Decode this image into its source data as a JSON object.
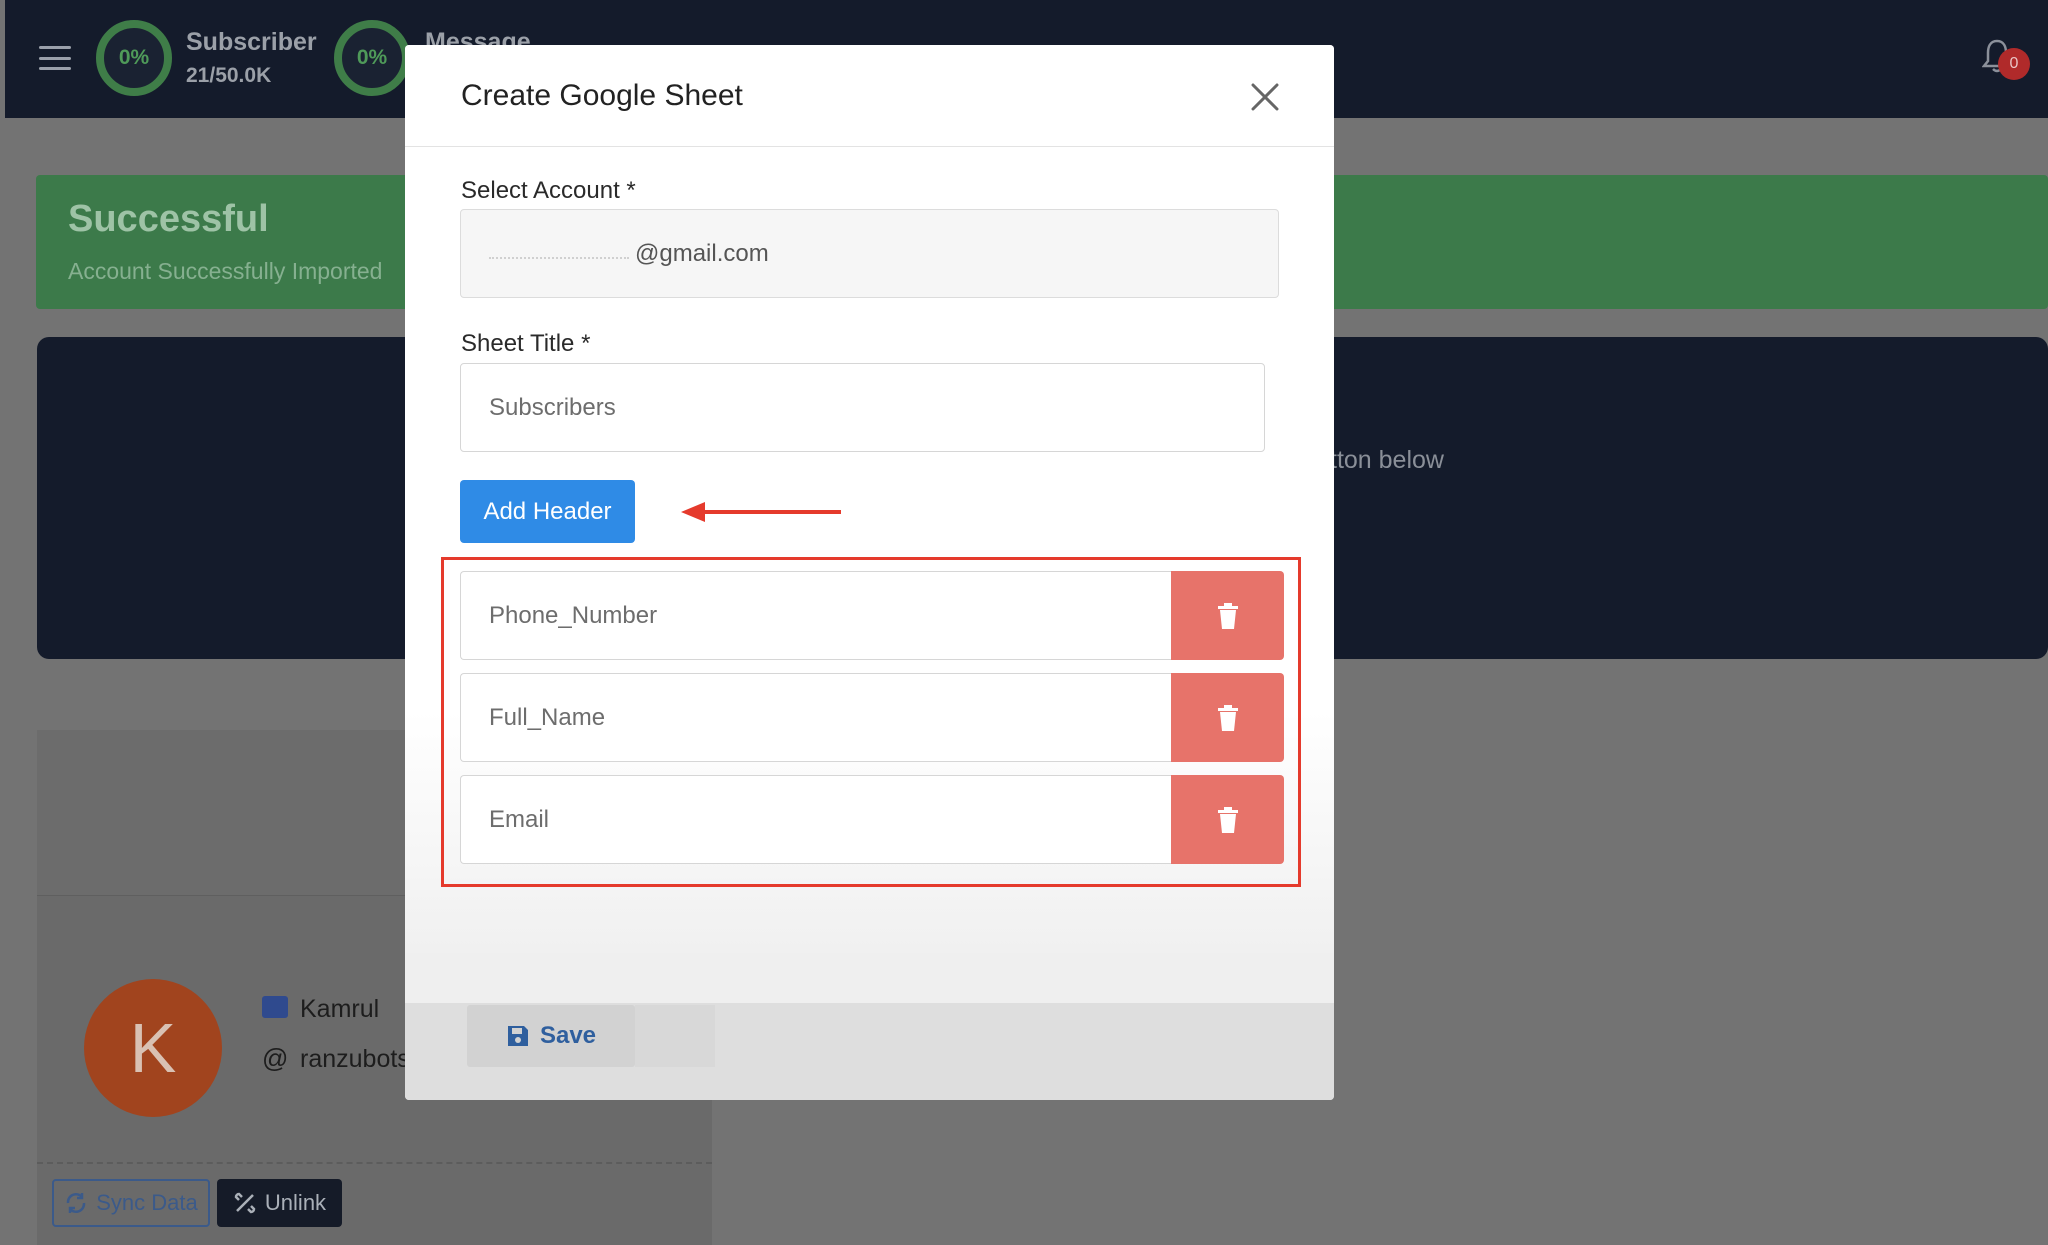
{
  "topbar": {
    "stats": [
      {
        "percent": "0%",
        "title": "Subscriber",
        "value": "21/50.0K"
      },
      {
        "percent": "0%",
        "title": "Message",
        "value": ""
      }
    ],
    "notification_count": "0"
  },
  "alert": {
    "title": "Successful",
    "message": "Account Successfully Imported"
  },
  "dark_card": {
    "text": "tton below"
  },
  "profile": {
    "avatar_letter": "K",
    "name": "Kamrul",
    "username": "ranzubots",
    "sync_label": "Sync Data",
    "unlink_label": "Unlink"
  },
  "modal": {
    "title": "Create Google Sheet",
    "select_account_label": "Select Account *",
    "selected_account": "@gmail.com",
    "sheet_title_label": "Sheet Title *",
    "sheet_title_value": "Subscribers",
    "add_header_label": "Add Header",
    "headers": [
      "Phone_Number",
      "Full_Name",
      "Email"
    ],
    "save_label": "Save"
  },
  "colors": {
    "accent_blue": "#2f8be6",
    "delete_red": "#e7736a",
    "highlight_red": "#e53a2c",
    "success_green": "#3c7a4a",
    "topbar_dark": "#141b2b"
  }
}
